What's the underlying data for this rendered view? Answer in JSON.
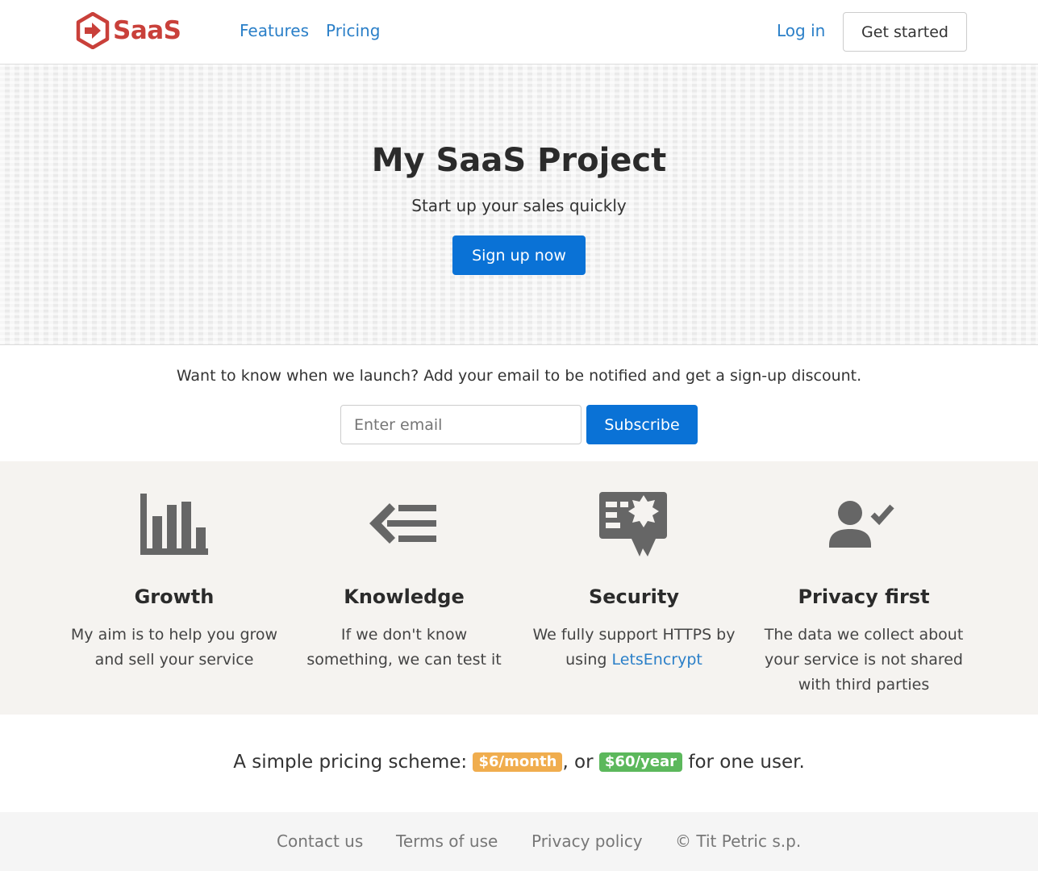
{
  "nav": {
    "brand": "SaaS",
    "links": [
      "Features",
      "Pricing"
    ],
    "login": "Log in",
    "get_started": "Get started"
  },
  "hero": {
    "title": "My SaaS Project",
    "subtitle": "Start up your sales quickly",
    "cta": "Sign up now"
  },
  "subscribe": {
    "text": "Want to know when we launch? Add your email to be notified and get a sign-up discount.",
    "placeholder": "Enter email",
    "button": "Subscribe"
  },
  "features": [
    {
      "icon": "bar-chart-icon",
      "title": "Growth",
      "text": "My aim is to help you grow and sell your service"
    },
    {
      "icon": "arrow-list-icon",
      "title": "Knowledge",
      "text": "If we don't know something, we can test it"
    },
    {
      "icon": "certificate-icon",
      "title": "Security",
      "text_before": "We fully support HTTPS by using ",
      "link": "LetsEncrypt"
    },
    {
      "icon": "user-check-icon",
      "title": "Privacy first",
      "text": "The data we collect about your service is not shared with third parties"
    }
  ],
  "pricing": {
    "prefix": "A simple pricing scheme: ",
    "monthly": "$6/month",
    "middle": ", or ",
    "yearly": "$60/year",
    "suffix": " for one user."
  },
  "footer": {
    "links": [
      "Contact us",
      "Terms of use",
      "Privacy policy",
      "© Tit Petric s.p."
    ]
  },
  "colors": {
    "brand": "#c9403a",
    "primary": "#0a72d6",
    "link": "#2a7fc8",
    "badge_orange": "#f0ad4e",
    "badge_green": "#5cb85c"
  }
}
